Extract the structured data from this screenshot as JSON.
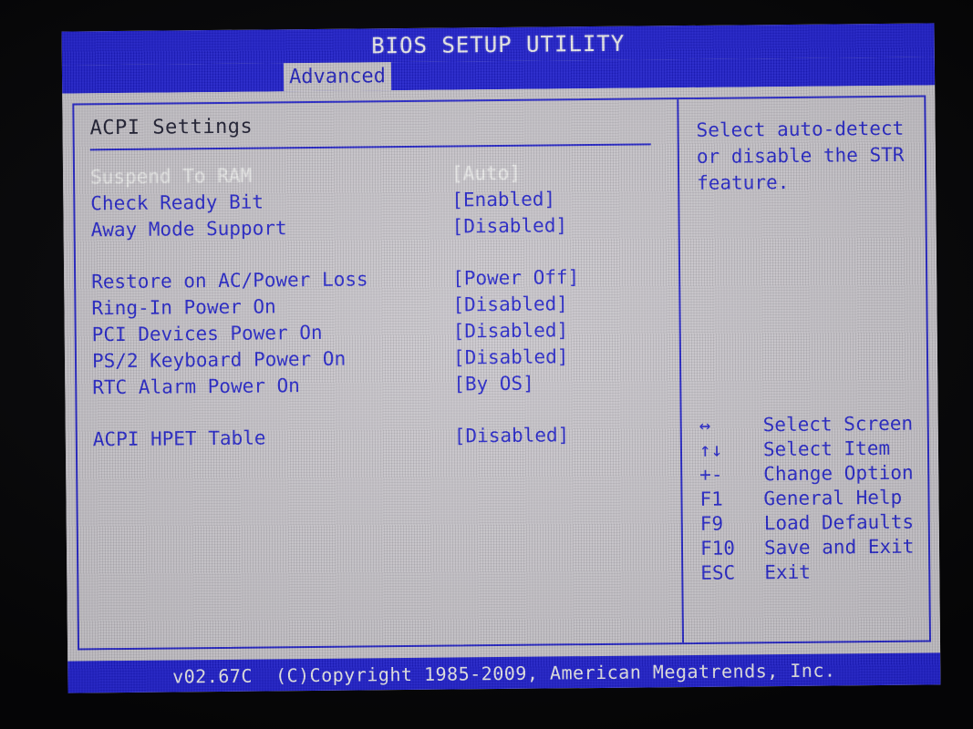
{
  "window": {
    "title": "BIOS SETUP UTILITY"
  },
  "menu": {
    "active_tab": "Advanced",
    "tabs": [
      "Advanced"
    ]
  },
  "page": {
    "section_title": "ACPI Settings"
  },
  "settings": [
    {
      "label": "Suspend To RAM",
      "value": "[Auto]",
      "selected": true
    },
    {
      "label": "Check Ready Bit",
      "value": "[Enabled]",
      "selected": false
    },
    {
      "label": "Away Mode Support",
      "value": "[Disabled]",
      "selected": false
    },
    {
      "label": "Restore on AC/Power Loss",
      "value": "[Power Off]",
      "selected": false
    },
    {
      "label": "Ring-In Power On",
      "value": "[Disabled]",
      "selected": false
    },
    {
      "label": "PCI Devices Power On",
      "value": "[Disabled]",
      "selected": false
    },
    {
      "label": "PS/2 Keyboard Power On",
      "value": "[Disabled]",
      "selected": false
    },
    {
      "label": "RTC Alarm Power On",
      "value": "[By OS]",
      "selected": false
    },
    {
      "label": "ACPI HPET Table",
      "value": "[Disabled]",
      "selected": false
    }
  ],
  "help": {
    "text": "Select auto-detect or disable the STR feature."
  },
  "key_legend": [
    {
      "key": "↔",
      "desc": "Select Screen"
    },
    {
      "key": "↑↓",
      "desc": "Select Item"
    },
    {
      "key": "+-",
      "desc": "Change Option"
    },
    {
      "key": "F1",
      "desc": "General Help"
    },
    {
      "key": "F9",
      "desc": "Load Defaults"
    },
    {
      "key": "F10",
      "desc": "Save and Exit"
    },
    {
      "key": "ESC",
      "desc": "Exit"
    }
  ],
  "footer": {
    "text": "v02.67C  (C)Copyright 1985-2009, American Megatrends, Inc."
  },
  "colors": {
    "chrome_blue": "#1919d2",
    "text_blue": "#1f1fcc",
    "screen_gray": "#c9c6cc",
    "selected_text": "#ececeb",
    "section_title": "#17172b",
    "bezel_black": "#050506"
  }
}
